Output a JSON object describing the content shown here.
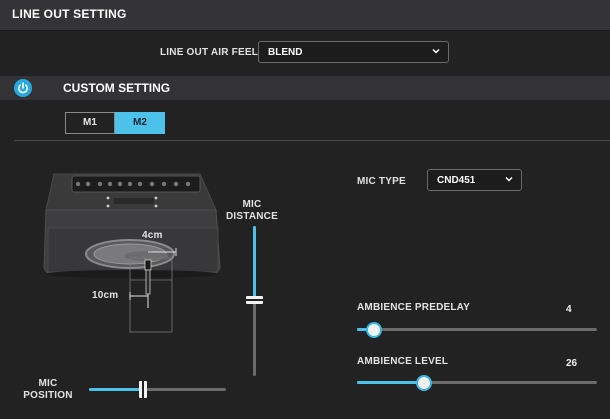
{
  "header": {
    "title": "LINE OUT SETTING"
  },
  "air_feel": {
    "label": "LINE OUT AIR FEEL",
    "value": "BLEND"
  },
  "custom": {
    "title": "CUSTOM SETTING",
    "power_on": true
  },
  "tabs": [
    {
      "label": "M1",
      "selected": false
    },
    {
      "label": "M2",
      "selected": true
    }
  ],
  "mic_type": {
    "label": "MIC TYPE",
    "value": "CND451"
  },
  "mic_distance": {
    "label_line1": "MIC",
    "label_line2": "DISTANCE"
  },
  "mic_position": {
    "label_line1": "MIC",
    "label_line2": "POSITION"
  },
  "amp": {
    "distance_marker": "4cm",
    "height_marker": "10cm"
  },
  "ambience_predelay": {
    "label": "AMBIENCE PREDELAY",
    "value": "4"
  },
  "ambience_level": {
    "label": "AMBIENCE LEVEL",
    "value": "26"
  },
  "colors": {
    "accent": "#4cc1ea",
    "bg": "#222223",
    "bar": "#343436"
  }
}
